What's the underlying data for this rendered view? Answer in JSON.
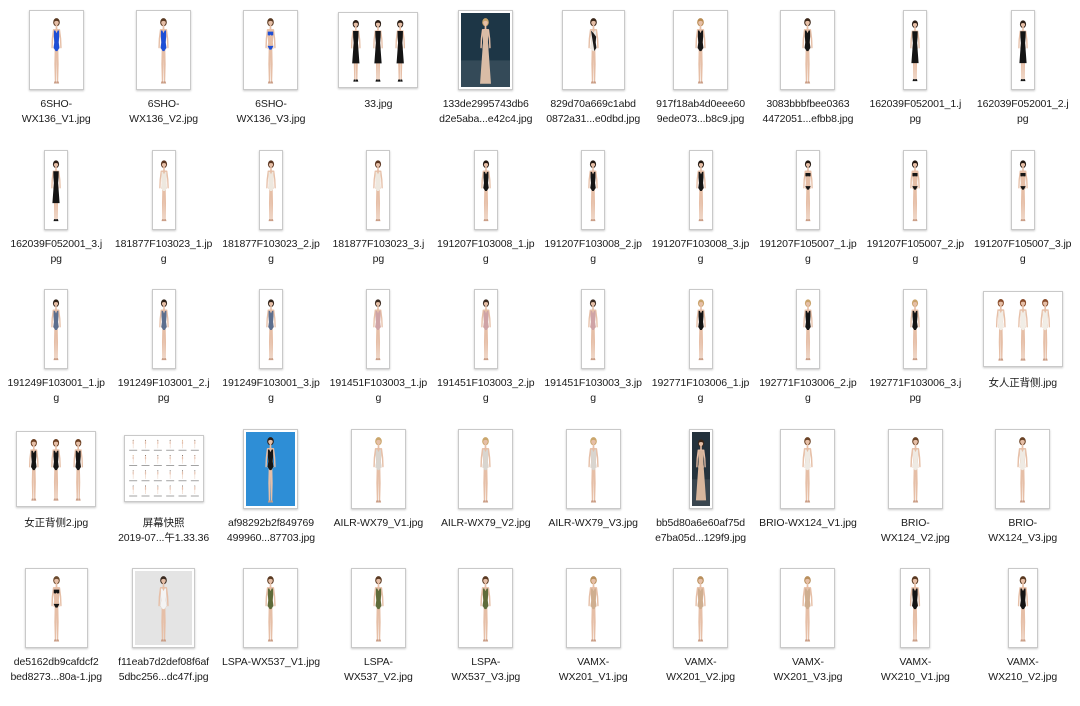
{
  "files": [
    {
      "name": "6SHO-\nWX136_V1.jpg",
      "suit": "#1e4fd6",
      "bg": "#ffffff"
    },
    {
      "name": "6SHO-\nWX136_V2.jpg",
      "suit": "#1e4fd6",
      "bg": "#ffffff"
    },
    {
      "name": "6SHO-\nWX136_V3.jpg",
      "suit": "#1e4fd6",
      "bg": "#ffffff"
    },
    {
      "name": "33.jpg",
      "suit": "#141414",
      "bg": "#ffffff"
    },
    {
      "name": "133de2995743db6\nd2e5aba...e42c4.jpg",
      "suit": "#d9bca6",
      "bg": "#1d3646"
    },
    {
      "name": "829d70a669c1abd\n0872a31...e0dbd.jpg",
      "suit": "#ece8e2",
      "accent": "#1a1a1a",
      "bg": "#ffffff"
    },
    {
      "name": "917f18ab4d0eee60\n9ede073...b8c9.jpg",
      "suit": "#161616",
      "bg": "#ffffff"
    },
    {
      "name": "3083bbbfbee0363\n4472051...efbb8.jpg",
      "suit": "#161616",
      "bg": "#ffffff"
    },
    {
      "name": "162039F052001_1.j\npg",
      "suit": "#141414",
      "bg": "#ffffff"
    },
    {
      "name": "162039F052001_2.j\npg",
      "suit": "#141414",
      "bg": "#ffffff"
    },
    {
      "name": "162039F052001_3.j\npg",
      "suit": "#141414",
      "bg": "#ffffff"
    },
    {
      "name": "181877F103023_1.jp\ng",
      "suit": "#eee8df",
      "bg": "#ffffff"
    },
    {
      "name": "181877F103023_2.jp\ng",
      "suit": "#eee8df",
      "bg": "#ffffff"
    },
    {
      "name": "181877F103023_3.j\npg",
      "suit": "#eee8df",
      "bg": "#ffffff"
    },
    {
      "name": "191207F103008_1.jp\ng",
      "suit": "#151515",
      "bg": "#ffffff"
    },
    {
      "name": "191207F103008_2.jp\ng",
      "suit": "#151515",
      "bg": "#ffffff"
    },
    {
      "name": "191207F103008_3.jp\ng",
      "suit": "#151515",
      "bg": "#ffffff"
    },
    {
      "name": "191207F105007_1.jp\ng",
      "suit": "#151515",
      "bg": "#ffffff"
    },
    {
      "name": "191207F105007_2.jp\ng",
      "suit": "#151515",
      "bg": "#ffffff"
    },
    {
      "name": "191207F105007_3.jp\ng",
      "suit": "#151515",
      "bg": "#ffffff"
    },
    {
      "name": "191249F103001_1.jp\ng",
      "suit": "#5d6f8e",
      "bg": "#ffffff"
    },
    {
      "name": "191249F103001_2.j\npg",
      "suit": "#5d6f8e",
      "bg": "#ffffff"
    },
    {
      "name": "191249F103001_3.jp\ng",
      "suit": "#5d6f8e",
      "bg": "#ffffff"
    },
    {
      "name": "191451F103003_1.jp\ng",
      "suit": "#cfa3a6",
      "bg": "#ffffff"
    },
    {
      "name": "191451F103003_2.jp\ng",
      "suit": "#cfa3a6",
      "bg": "#ffffff"
    },
    {
      "name": "191451F103003_3.jp\ng",
      "suit": "#cfa3a6",
      "bg": "#ffffff"
    },
    {
      "name": "192771F103006_1.jp\ng",
      "suit": "#141414",
      "bg": "#ffffff"
    },
    {
      "name": "192771F103006_2.jp\ng",
      "suit": "#141414",
      "bg": "#ffffff"
    },
    {
      "name": "192771F103006_3.j\npg",
      "suit": "#141414",
      "bg": "#ffffff"
    },
    {
      "name": "女人正背侧.jpg",
      "suit": "#f1ede6",
      "bg": "#ffffff"
    },
    {
      "name": "女正背侧2.jpg",
      "suit": "#151515",
      "bg": "#ffffff"
    },
    {
      "name": "屏幕快照\n2019-07...午1.33.36",
      "suit": "#e2b8a6",
      "bg": "#ffffff"
    },
    {
      "name": "af98292b2f849769\n499960...87703.jpg",
      "suit": "#151515",
      "bg": "#2e8ed6"
    },
    {
      "name": "AILR-WX79_V1.jpg",
      "suit": "#d9d5cf",
      "bg": "#ffffff"
    },
    {
      "name": "AILR-WX79_V2.jpg",
      "suit": "#d9d5cf",
      "bg": "#ffffff"
    },
    {
      "name": "AILR-WX79_V3.jpg",
      "suit": "#d9d5cf",
      "bg": "#ffffff"
    },
    {
      "name": "bb5d80a6e60af75d\ne7ba05d...129f9.jpg",
      "suit": "#d8b69c",
      "bg": "#24323c"
    },
    {
      "name": "BRIO-WX124_V1.jpg",
      "suit": "#efeae3",
      "bg": "#ffffff"
    },
    {
      "name": "BRIO-\nWX124_V2.jpg",
      "suit": "#efeae3",
      "bg": "#ffffff"
    },
    {
      "name": "BRIO-\nWX124_V3.jpg",
      "suit": "#efeae3",
      "bg": "#ffffff"
    },
    {
      "name": "de5162db9cafdcf2\nbed8273...80a-1.jpg",
      "suit": "#141414",
      "bg": "#ffffff"
    },
    {
      "name": "f11eab7d2def08f6af\n5dbc256...dc47f.jpg",
      "suit": "#f4f4f4",
      "bg": "#e4e4e4"
    },
    {
      "name": "LSPA-WX537_V1.jpg",
      "suit": "#5e6b3a",
      "bg": "#ffffff"
    },
    {
      "name": "LSPA-\nWX537_V2.jpg",
      "suit": "#5e6b3a",
      "bg": "#ffffff"
    },
    {
      "name": "LSPA-\nWX537_V3.jpg",
      "suit": "#5e6b3a",
      "bg": "#ffffff"
    },
    {
      "name": "VAMX-\nWX201_V1.jpg",
      "suit": "#cfae8f",
      "bg": "#ffffff"
    },
    {
      "name": "VAMX-\nWX201_V2.jpg",
      "suit": "#cfae8f",
      "bg": "#ffffff"
    },
    {
      "name": "VAMX-\nWX201_V3.jpg",
      "suit": "#cfae8f",
      "bg": "#ffffff"
    },
    {
      "name": "VAMX-\nWX210_V1.jpg",
      "suit": "#141414",
      "bg": "#ffffff"
    },
    {
      "name": "VAMX-\nWX210_V2.jpg",
      "suit": "#141414",
      "bg": "#ffffff"
    }
  ]
}
